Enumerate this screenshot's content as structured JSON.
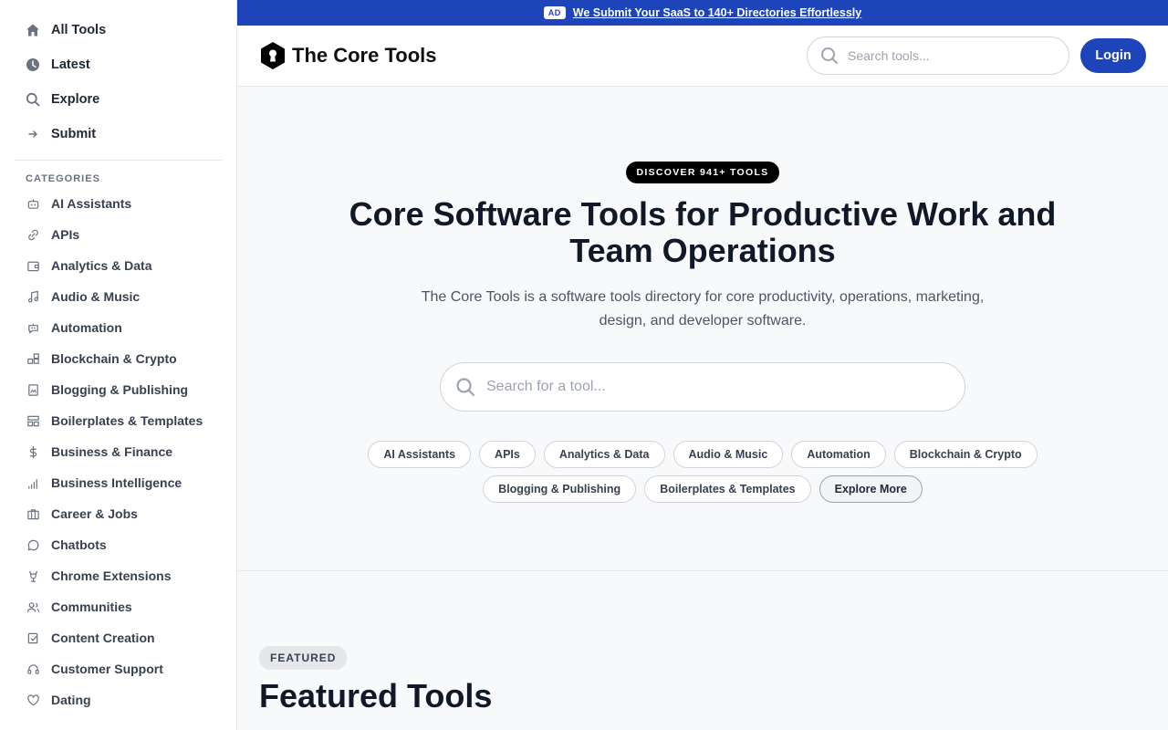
{
  "sidebar": {
    "nav": [
      {
        "label": "All Tools",
        "icon": "home-icon"
      },
      {
        "label": "Latest",
        "icon": "clock-icon"
      },
      {
        "label": "Explore",
        "icon": "search-icon"
      },
      {
        "label": "Submit",
        "icon": "arrow-right-icon"
      }
    ],
    "categories_heading": "CATEGORIES",
    "categories": [
      {
        "label": "AI Assistants",
        "icon": "robot-icon"
      },
      {
        "label": "APIs",
        "icon": "link-icon"
      },
      {
        "label": "Analytics & Data",
        "icon": "wallet-icon"
      },
      {
        "label": "Audio & Music",
        "icon": "music-note-icon"
      },
      {
        "label": "Automation",
        "icon": "bot-icon"
      },
      {
        "label": "Blockchain & Crypto",
        "icon": "blocks-icon"
      },
      {
        "label": "Blogging & Publishing",
        "icon": "book-icon"
      },
      {
        "label": "Boilerplates & Templates",
        "icon": "layout-icon"
      },
      {
        "label": "Business & Finance",
        "icon": "dollar-icon"
      },
      {
        "label": "Business Intelligence",
        "icon": "signal-bars-icon"
      },
      {
        "label": "Career & Jobs",
        "icon": "briefcase-icon"
      },
      {
        "label": "Chatbots",
        "icon": "chat-bubble-icon"
      },
      {
        "label": "Chrome Extensions",
        "icon": "puzzle-icon"
      },
      {
        "label": "Communities",
        "icon": "users-icon"
      },
      {
        "label": "Content Creation",
        "icon": "edit-icon"
      },
      {
        "label": "Customer Support",
        "icon": "headset-icon"
      },
      {
        "label": "Dating",
        "icon": "heart-icon"
      }
    ]
  },
  "ad": {
    "badge": "AD",
    "text": "We Submit Your SaaS to 140+ Directories Effortlessly"
  },
  "header": {
    "logo_text": "The Core Tools",
    "search_placeholder": "Search tools...",
    "login_label": "Login"
  },
  "hero": {
    "badge": "DISCOVER 941+ TOOLS",
    "title": "Core Software Tools for Productive Work and Team Operations",
    "subtitle": "The Core Tools is a software tools directory for core productivity, operations, marketing, design, and developer software.",
    "search_placeholder": "Search for a tool...",
    "chips": [
      "AI Assistants",
      "APIs",
      "Analytics & Data",
      "Audio & Music",
      "Automation",
      "Blockchain & Crypto",
      "Blogging & Publishing",
      "Boilerplates & Templates"
    ],
    "explore_more": "Explore More"
  },
  "featured": {
    "badge": "FEATURED",
    "title": "Featured Tools"
  },
  "colors": {
    "brand_blue": "#1d44b8",
    "sidebar_bg": "#ffffff",
    "page_bg": "#f8f9fb"
  }
}
